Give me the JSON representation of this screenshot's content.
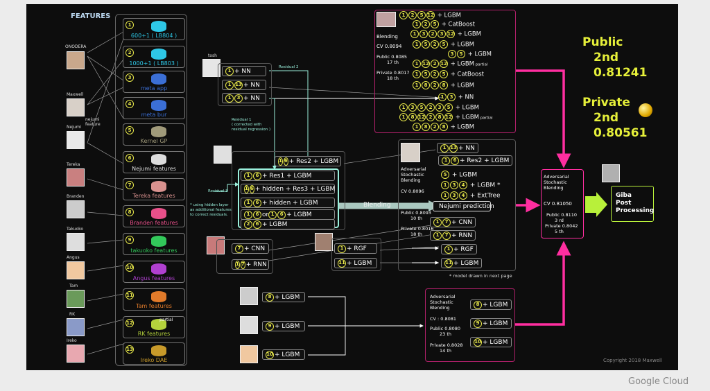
{
  "footer_brand": "Google Cloud",
  "copyright": "Copyright 2018 Maxwell",
  "features_title": "FEATURES",
  "features": [
    {
      "num": "1",
      "label": "600+1 ( LB804 )",
      "color": "#2ec7e6"
    },
    {
      "num": "2",
      "label": "1000+1 ( LB803 )",
      "color": "#2ec7e6"
    },
    {
      "num": "3",
      "label": "meta app",
      "color": "#3b6fd6"
    },
    {
      "num": "4",
      "label": "meta bur",
      "color": "#3b6fd6"
    },
    {
      "num": "5",
      "label": "Kernel GP",
      "color": "#a09a7a"
    },
    {
      "num": "6",
      "label": "Nejumi features",
      "color": "#dddddd"
    },
    {
      "num": "7",
      "label": "Tereka features",
      "color": "#d9928f"
    },
    {
      "num": "8",
      "label": "Branden features",
      "color": "#e8508a"
    },
    {
      "num": "9",
      "label": "takuoko features",
      "color": "#32c85a"
    },
    {
      "num": "10",
      "label": "Angus features",
      "color": "#b040d0"
    },
    {
      "num": "11",
      "label": "Tam features",
      "color": "#e07a2a"
    },
    {
      "num": "12",
      "label": "RK features",
      "color": "#b4d23c"
    },
    {
      "num": "13",
      "label": "Ireko DAE",
      "color": "#c89a2a"
    }
  ],
  "rk_partial": "partial",
  "people": {
    "onodera": "ONODERA",
    "maxwell": "Maxwell",
    "nejumi_feature": "nejumi\nfeature",
    "nejumi": "Nejumi",
    "tereka": "Tereka",
    "branden": "Branden",
    "takuoko": "Takuoko",
    "angus": "Angus",
    "tam": "Tam",
    "rk": "RK",
    "ireko": "Ireko",
    "tosh": "tosh"
  },
  "tosh_models": [
    {
      "circles": [
        "1"
      ],
      "text": "+ NN"
    },
    {
      "circles": [
        "1",
        "13"
      ],
      "text": "+ NN"
    },
    {
      "circles": [
        "1",
        "3"
      ],
      "text": "+ NN"
    }
  ],
  "residual2": "Residual 2",
  "residual1": "Residual 1\n( corrected with\nresidual regression )",
  "residual3": "Residual 3",
  "hidden_note": "* using hidden layer\nas additional features\nto correct residuals.",
  "res2_model": {
    "circles": [
      "1",
      "6"
    ],
    "text": "+ Res2 + LGBM"
  },
  "nejumi_models": [
    {
      "circles": [
        "1",
        "6"
      ],
      "text": "+ Res1 + LGBM"
    },
    {
      "circles": [
        "1",
        "6"
      ],
      "text": "+ hidden + Res3 + LGBM"
    },
    {
      "circles": [
        "1",
        "6"
      ],
      "text": "+ hidden + LGBM"
    },
    {
      "circles": [
        "1",
        "6"
      ],
      "mid": "or",
      "circles2": [
        "1",
        "6"
      ],
      "text": "+ LGBM"
    },
    {
      "circles": [
        "2",
        "6"
      ],
      "text": "+ LGBM"
    }
  ],
  "blending_label": "Blending",
  "nejumi_prediction": "Nejumi  prediction",
  "cnn_models": [
    {
      "circles": [
        "7"
      ],
      "text": "+ CNN"
    },
    {
      "circles": [
        "1",
        "7"
      ],
      "text": "+ RNN"
    }
  ],
  "rgf_models": [
    {
      "circles": [
        "1"
      ],
      "text": "+ RGF"
    },
    {
      "circles": [
        "11"
      ],
      "text": "+ LGBM"
    }
  ],
  "top_box": {
    "rows": [
      {
        "c": [
          "1",
          "2",
          "5",
          "12"
        ],
        "text": "+ LGBM",
        "note": ""
      },
      {
        "c": [
          "1",
          "2",
          "5"
        ],
        "text": "+ CatBoost",
        "note": ""
      },
      {
        "c": [
          "1",
          "3",
          "2",
          "3",
          "12"
        ],
        "text": "+ LGBM",
        "note": ""
      },
      {
        "c": [
          "1",
          "5",
          "2",
          "5"
        ],
        "text": "+ LGBM",
        "note": ""
      },
      {
        "c": [
          "3",
          "5"
        ],
        "text": "+ LGBM",
        "note": ""
      },
      {
        "c": [
          "1",
          "12",
          "2",
          "12"
        ],
        "text": "+ LGBM",
        "note": "partial"
      },
      {
        "c": [
          "1",
          "5",
          "2",
          "5"
        ],
        "text": "+ CatBoost",
        "note": ""
      },
      {
        "c": [
          "1",
          "8",
          "2",
          "8"
        ],
        "text": "+ LGBM",
        "note": ""
      },
      {
        "c": [
          "1",
          "3"
        ],
        "text": "+ NN",
        "note": ""
      },
      {
        "c": [
          "1",
          "3",
          "5",
          "2",
          "3",
          "5"
        ],
        "text": "+ LGBM",
        "note": ""
      },
      {
        "c": [
          "1",
          "8",
          "12",
          "2",
          "8",
          "12"
        ],
        "text": "+ LGBM",
        "note": "partial"
      },
      {
        "c": [
          "1",
          "8",
          "2",
          "8"
        ],
        "text": "+ LGBM",
        "note": ""
      }
    ],
    "blending": "Blending",
    "cv": "CV 0.8094",
    "public": "Public 0.8085",
    "public_rank": "17 th",
    "private": "Private 0.8017",
    "private_rank": "18 th"
  },
  "mid_box": {
    "rows": [
      {
        "c": [
          "1",
          "13"
        ],
        "text": "+ NN"
      },
      {
        "c": [
          "1",
          "6"
        ],
        "text": "+ Res2 + LGBM"
      },
      {
        "c": [
          "5"
        ],
        "text": "+ LGBM"
      },
      {
        "c": [
          "1",
          "3",
          "4"
        ],
        "text": "+ LGBM *"
      },
      {
        "c": [
          "1",
          "3",
          "4"
        ],
        "text": "+ ExtTree"
      },
      {
        "c": [
          "1",
          "7"
        ],
        "text": "+ CNN"
      },
      {
        "c": [
          "1",
          "7"
        ],
        "text": "+ RNN"
      },
      {
        "c": [
          "1"
        ],
        "text": "+ RGF"
      },
      {
        "c": [
          "11"
        ],
        "text": "+ LGBM"
      }
    ],
    "title": "Adversarial\nStochastic\nBlending",
    "cv": "CV 0.8096",
    "public": "Public 0.8093",
    "public_rank": "10 th",
    "private": "Private 0.8016",
    "private_rank": "18 th",
    "note": "* model drawn in next page"
  },
  "bottom_models": [
    {
      "c": [
        "8"
      ],
      "text": "+ LGBM"
    },
    {
      "c": [
        "9"
      ],
      "text": "+ LGBM"
    },
    {
      "c": [
        "10"
      ],
      "text": "+ LGBM"
    }
  ],
  "bottom_box": {
    "title": "Adversarial\nStochastic\nBlending",
    "cv": "CV : 0.8081",
    "public": "Public 0.8080",
    "public_rank": "23 th",
    "private": "Private 0.8028",
    "private_rank": "14 th",
    "rows": [
      {
        "c": [
          "8"
        ],
        "text": "+ LGBM"
      },
      {
        "c": [
          "9"
        ],
        "text": "+ LGBM"
      },
      {
        "c": [
          "10"
        ],
        "text": "+ LGBM"
      }
    ]
  },
  "final_box": {
    "title": "Adversarial\nStochastic\nBlending",
    "cv": "CV 0.81050",
    "public": "Public 0.8110",
    "public_rank": "3 rd",
    "private": "Private 0.8042",
    "private_rank": "5 th"
  },
  "giba_box": "Giba\nPost\nProcessing",
  "result": {
    "public_label": "Public",
    "public_place": "2nd",
    "public_score": "0.81241",
    "private_label": "Private",
    "private_place": "2nd",
    "private_score": "0.80561"
  },
  "colors": {
    "accent": "#ff2ea0",
    "cyan": "#9af0dc",
    "yellow": "#e6f03a"
  }
}
